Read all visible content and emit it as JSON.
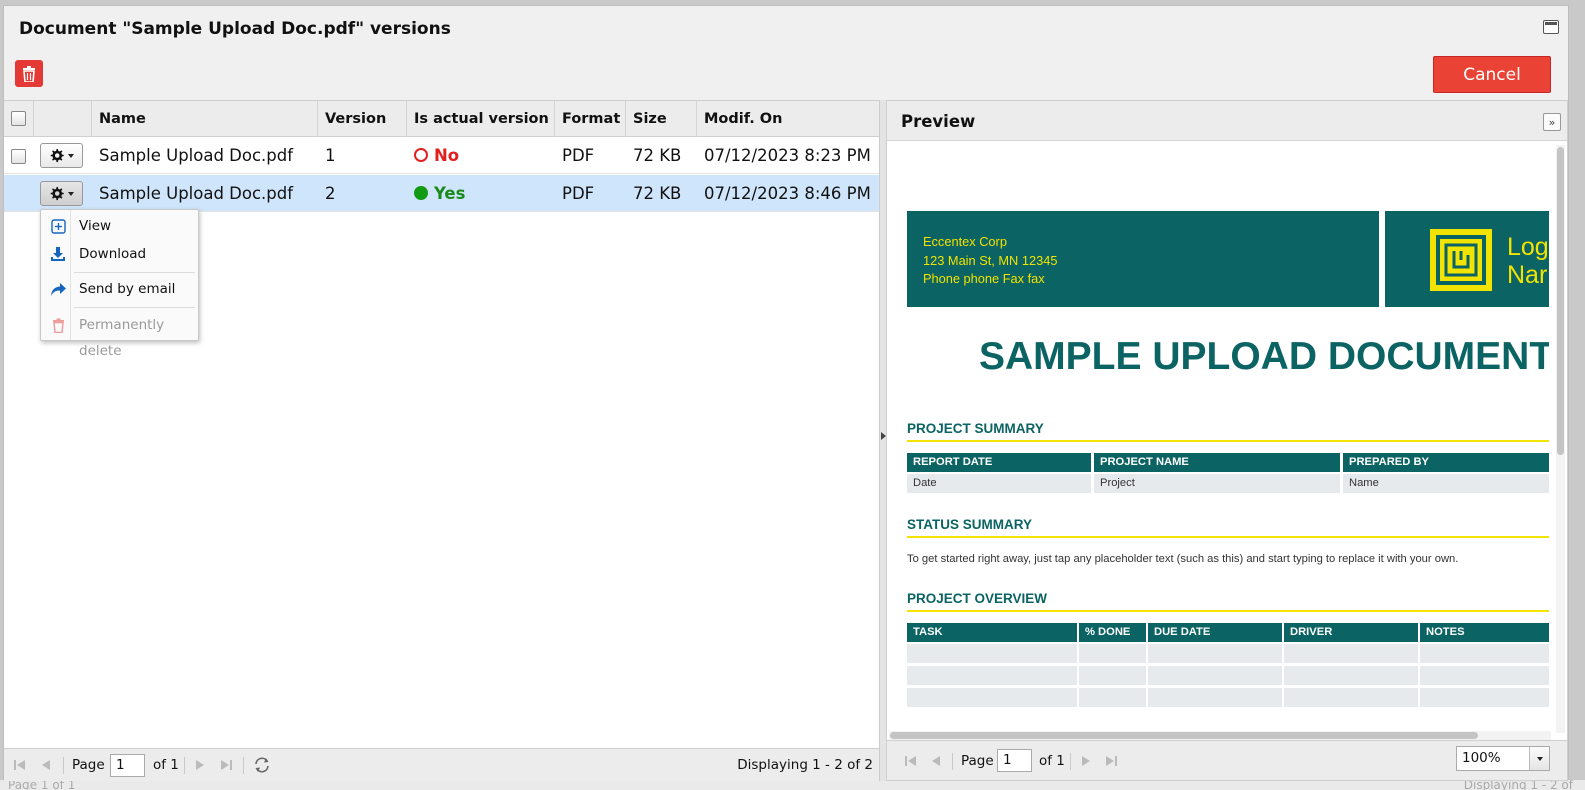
{
  "window": {
    "title": "Document \"Sample Upload Doc.pdf\" versions",
    "cancel_label": "Cancel"
  },
  "grid": {
    "columns": [
      "Name",
      "Version",
      "Is actual version",
      "Format",
      "Size",
      "Modif. On"
    ],
    "rows": [
      {
        "name": "Sample Upload Doc.pdf",
        "version": "1",
        "actual": "No",
        "format": "PDF",
        "size": "72 KB",
        "modified": "07/12/2023 8:23 PM",
        "selected": false
      },
      {
        "name": "Sample Upload Doc.pdf",
        "version": "2",
        "actual": "Yes",
        "format": "PDF",
        "size": "72 KB",
        "modified": "07/12/2023 8:46 PM",
        "selected": true
      }
    ]
  },
  "context_menu": {
    "items": [
      {
        "label": "View",
        "icon": "view-plus-icon",
        "enabled": true
      },
      {
        "label": "Download",
        "icon": "download-icon",
        "enabled": true
      },
      {
        "label": "Send by email",
        "icon": "share-arrow-icon",
        "enabled": true
      },
      {
        "label": "Permanently delete",
        "icon": "trash-icon",
        "enabled": false
      }
    ]
  },
  "pager": {
    "page_label": "Page",
    "page_value": "1",
    "of_label": "of 1",
    "display_text": "Displaying 1 - 2 of 2"
  },
  "preview": {
    "title": "Preview",
    "page_label": "Page",
    "page_value": "1",
    "of_label": "of 1",
    "zoom": "100%",
    "document": {
      "address_lines": [
        "Eccentex Corp",
        "123 Main St, MN 12345",
        "Phone phone  Fax fax"
      ],
      "logo_text_1": "Log",
      "logo_text_2": "Nar",
      "main_title": "SAMPLE UPLOAD DOCUMENT",
      "project_summary": "PROJECT SUMMARY",
      "summary_headers": [
        "REPORT DATE",
        "PROJECT NAME",
        "PREPARED BY"
      ],
      "summary_values": [
        "Date",
        "Project",
        "Name"
      ],
      "status_summary": "STATUS SUMMARY",
      "status_text": "To get started right away, just tap any placeholder text (such as this) and start typing to replace it with your own.",
      "project_overview": "PROJECT OVERVIEW",
      "overview_headers": [
        "TASK",
        "% DONE",
        "DUE DATE",
        "DRIVER",
        "NOTES"
      ]
    }
  },
  "background_strip": {
    "left": "Page  1    of 1",
    "right": "Displaying 1 - 2 of"
  },
  "colors": {
    "danger": "#ea4335",
    "selected_row": "#cfe5fb",
    "doc_teal": "#0b6363",
    "doc_yellow": "#f2e300",
    "yes_green": "#1a8a1a",
    "no_red": "#e21f1f"
  }
}
